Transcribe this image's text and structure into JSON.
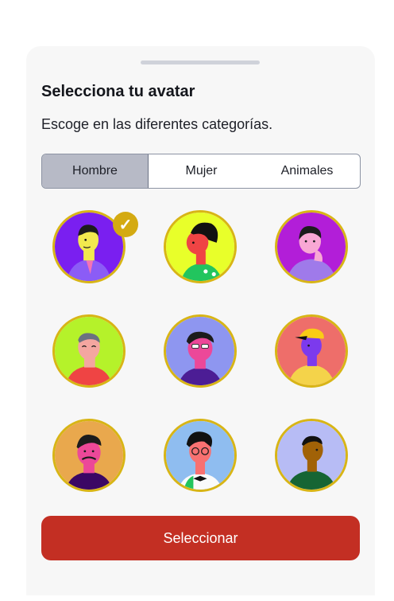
{
  "sheet": {
    "title": "Selecciona tu avatar",
    "subtitle": "Escoge en las diferentes categorías."
  },
  "tabs": [
    {
      "label": "Hombre",
      "active": true
    },
    {
      "label": "Mujer",
      "active": false
    },
    {
      "label": "Animales",
      "active": false
    }
  ],
  "avatars": [
    {
      "name": "avatar-1",
      "bg": "#7a1ff0",
      "selected": true
    },
    {
      "name": "avatar-2",
      "bg": "#e8ff2a",
      "selected": false
    },
    {
      "name": "avatar-3",
      "bg": "#b21ed8",
      "selected": false
    },
    {
      "name": "avatar-4",
      "bg": "#b5f22a",
      "selected": false
    },
    {
      "name": "avatar-5",
      "bg": "#8e96f0",
      "selected": false
    },
    {
      "name": "avatar-6",
      "bg": "#ee6e6a",
      "selected": false
    },
    {
      "name": "avatar-7",
      "bg": "#e9a84d",
      "selected": false
    },
    {
      "name": "avatar-8",
      "bg": "#8fbdf0",
      "selected": false
    },
    {
      "name": "avatar-9",
      "bg": "#b7bcf5",
      "selected": false
    }
  ],
  "check_glyph": "✓",
  "button": {
    "label": "Seleccionar"
  },
  "colors": {
    "accent": "#c32f23",
    "ring": "#d8b516",
    "tab_active": "#b7bac6"
  }
}
